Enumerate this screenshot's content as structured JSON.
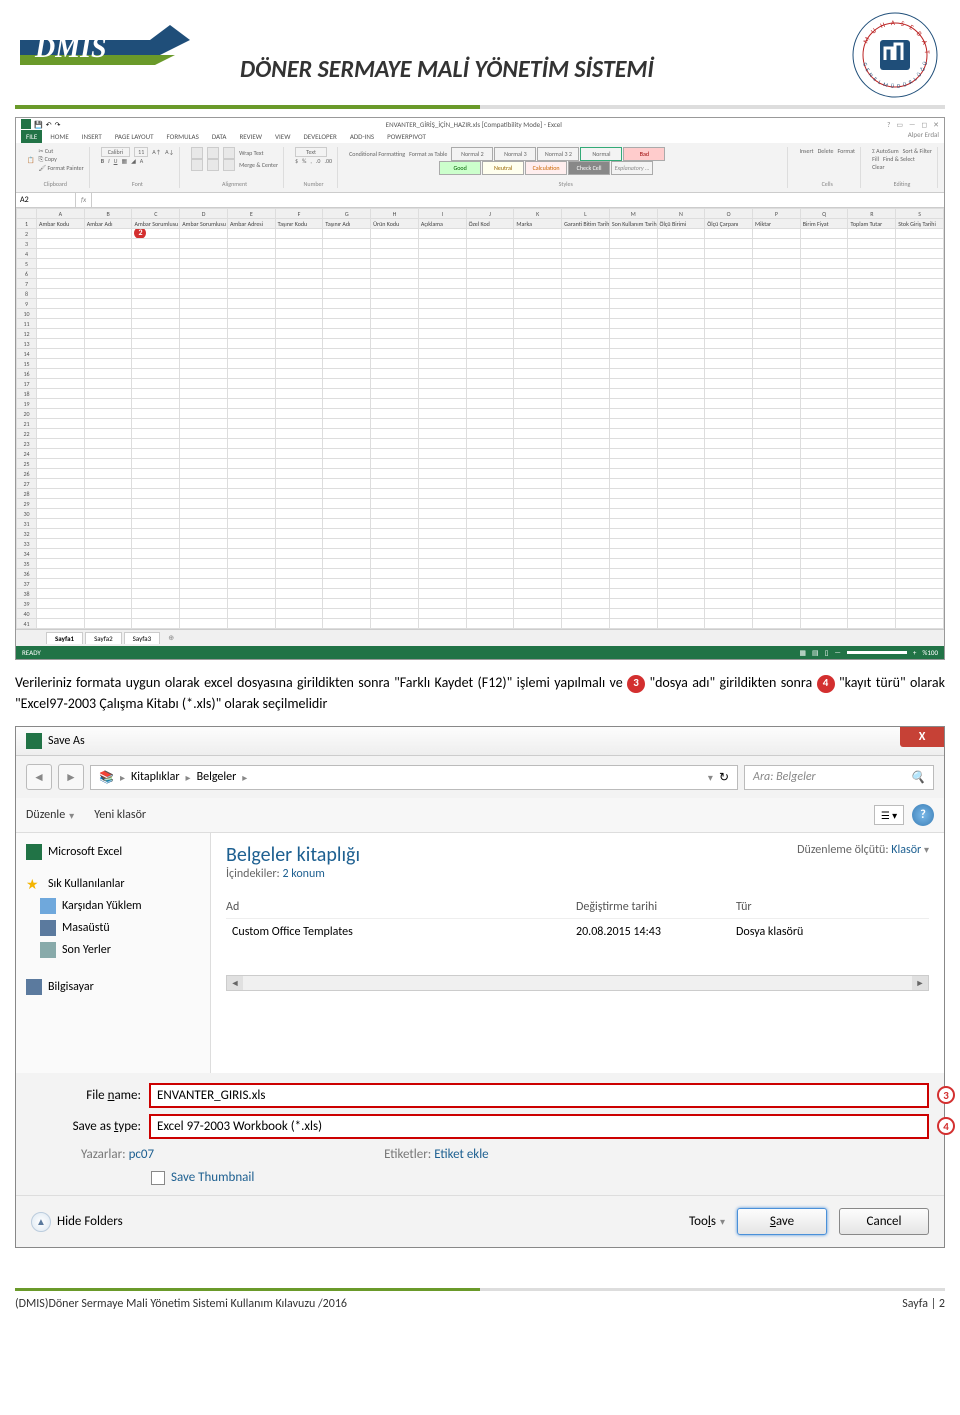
{
  "header": {
    "logo_text": "DMIS",
    "title": "DÖNER SERMAYE MALİ YÖNETİM SİSTEMİ",
    "org_top": "MUHASEBAT",
    "org_bottom": "GENEL MÜDÜRLÜĞÜ"
  },
  "excel": {
    "title": "ENVANTER_GİRİŞ_İÇİN_HAZIR.xls  [Compatibility Mode] - Excel",
    "user": "Alper Erdal",
    "tabs": [
      "FILE",
      "HOME",
      "INSERT",
      "PAGE LAYOUT",
      "FORMULAS",
      "DATA",
      "REVIEW",
      "VIEW",
      "DEVELOPER",
      "ADD-INS",
      "POWERPIVOT"
    ],
    "clipboard": {
      "cut": "Cut",
      "copy": "Copy",
      "painter": "Format Painter",
      "label": "Clipboard"
    },
    "font": {
      "name": "Calibri",
      "size": "11",
      "label": "Font"
    },
    "alignment": {
      "wrap": "Wrap Text",
      "merge": "Merge & Center",
      "label": "Alignment"
    },
    "number": {
      "format": "Text",
      "label": "Number"
    },
    "styles": {
      "cond": "Conditional Formatting",
      "fmtas": "Format as Table",
      "cells": [
        "Normal 2",
        "Normal 3",
        "Normal 3 2",
        "Normal",
        "Bad",
        "Good",
        "Neutral",
        "Calculation",
        "Check Cell",
        "Explanatory ..."
      ],
      "label": "Styles"
    },
    "cells_grp": {
      "insert": "Insert",
      "delete": "Delete",
      "format": "Format",
      "label": "Cells"
    },
    "editing": {
      "autosum": "AutoSum",
      "fill": "Fill",
      "clear": "Clear",
      "sort": "Sort & Filter",
      "find": "Find & Select",
      "label": "Editing"
    },
    "name_box": "A2",
    "columns": [
      "A",
      "B",
      "C",
      "D",
      "E",
      "F",
      "G",
      "H",
      "I",
      "J",
      "K",
      "L",
      "M",
      "N",
      "O",
      "P",
      "Q",
      "R",
      "S"
    ],
    "data_headers": [
      "Ambar Kodu",
      "Ambar Adı",
      "Ambar Sorumlusu Tc",
      "Ambar Sorumlusu Adı",
      "Ambar Adresi",
      "Taşınır Kodu",
      "Taşınır Adı",
      "Ürün Kodu",
      "Açıklama",
      "Özel Kod",
      "Marka",
      "Garanti Bitim Tarihi",
      "Son Kullanım Tarihi",
      "Ölçü Birimi",
      "Ölçü Çarpanı",
      "Miktar",
      "Birim Fiyat",
      "Toplam Tutar",
      "Stok Giriş Tarihi"
    ],
    "marker2": "2",
    "row_count": 41,
    "sheets": [
      "Sayfa1",
      "Sayfa2",
      "Sayfa3"
    ],
    "status_ready": "READY",
    "zoom": "%100"
  },
  "body_text": {
    "p1_a": "Verileriniz formata uygun olarak excel dosyasına girildikten sonra \"Farklı Kaydet (F12)\" işlemi yapılmalı ve ",
    "m3": "3",
    "p1_b": " \"dosya adı\" girildikten sonra ",
    "m4": "4",
    "p1_c": " \"kayıt türü\" olarak \"Excel97-2003 Çalışma Kitabı (*.xls)\" olarak seçilmelidir"
  },
  "saveas": {
    "title": "Save As",
    "close": "X",
    "breadcrumb": [
      "Kitaplıklar",
      "Belgeler"
    ],
    "search_placeholder": "Ara: Belgeler",
    "organize": "Düzenle",
    "new_folder": "Yeni klasör",
    "nav_items": [
      {
        "icon": "excel",
        "label": "Microsoft Excel"
      },
      {
        "icon": "star",
        "label": "Sık Kullanılanlar"
      },
      {
        "icon": "folder",
        "label": "Karşıdan Yüklem"
      },
      {
        "icon": "desktop",
        "label": "Masaüstü"
      },
      {
        "icon": "recent",
        "label": "Son Yerler"
      },
      {
        "icon": "computer",
        "label": "Bilgisayar"
      }
    ],
    "lib_title": "Belgeler kitaplığı",
    "lib_sub_label": "İçindekiler:",
    "lib_sub_value": "2 konum",
    "arrange_label": "Düzenleme ölçütü:",
    "arrange_value": "Klasör",
    "cols": {
      "name": "Ad",
      "date": "Değiştirme tarihi",
      "type": "Tür"
    },
    "files": [
      {
        "name": "Custom Office Templates",
        "date": "20.08.2015 14:43",
        "type": "Dosya klasörü"
      }
    ],
    "filename_label": "File name:",
    "filename_value": "ENVANTER_GIRIS.xls",
    "filename_marker": "3",
    "savetype_label": "Save as type:",
    "savetype_value": "Excel 97-2003 Workbook (*.xls)",
    "savetype_marker": "4",
    "authors_label": "Yazarlar:",
    "authors_value": "pc07",
    "tags_label": "Etiketler:",
    "tags_value": "Etiket ekle",
    "save_thumbnail": "Save Thumbnail",
    "hide_folders": "Hide Folders",
    "tools": "Tools",
    "save_btn": "Save",
    "cancel_btn": "Cancel"
  },
  "footer": {
    "left": "(DMIS)Döner Sermaye Mali Yönetim Sistemi Kullanım Kılavuzu /2016",
    "right": "Sayfa | 2"
  }
}
